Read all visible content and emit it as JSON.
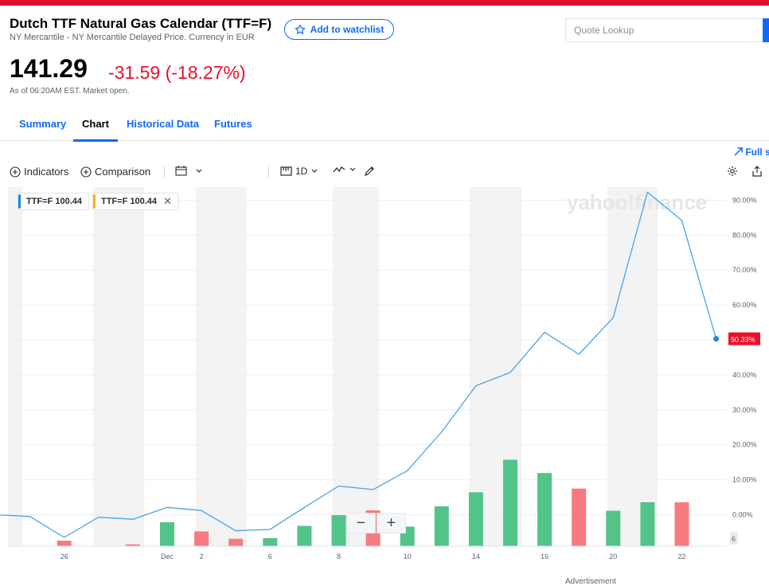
{
  "colors": {
    "accent": "#0f69ff",
    "negative": "#eb0f29",
    "topbar": "#e0102f",
    "up_bar": "#52c48a",
    "down_bar": "#f87a7e",
    "line": "#4aa3e8"
  },
  "quote": {
    "title": "Dutch TTF Natural Gas Calendar (TTF=F)",
    "subtitle": "NY Mercantile - NY Mercantile Delayed Price. Currency in EUR",
    "watchlist_label": "Add to watchlist",
    "price": "141.29",
    "change": "-31.59 (-18.27%)",
    "as_of": "As of 06:20AM EST. Market open."
  },
  "search": {
    "placeholder": "Quote Lookup"
  },
  "tabs": [
    {
      "label": "Summary",
      "active": false
    },
    {
      "label": "Chart",
      "active": true
    },
    {
      "label": "Historical Data",
      "active": false
    },
    {
      "label": "Futures",
      "active": false
    }
  ],
  "fullscreen_label": "Full s",
  "toolbar": {
    "indicators_label": "Indicators",
    "comparison_label": "Comparison",
    "range_label": "1D"
  },
  "legend_chips": [
    {
      "text": "TTF=F  100.44",
      "color": "#1e88e5"
    },
    {
      "text": "TTF=F  100.44",
      "color": "#f5b700"
    }
  ],
  "watermark": "yahoo!finance",
  "advertisement": "Advertisement",
  "chart_data": {
    "type": "line",
    "ylim": [
      -9,
      95
    ],
    "y_ticks": [
      "90.00%",
      "80.00%",
      "70.00%",
      "60.00%",
      "50.00%",
      "40.00%",
      "30.00%",
      "20.00%",
      "10.00%",
      "0.00%"
    ],
    "y_tick_values": [
      90,
      80,
      70,
      60,
      50,
      40,
      30,
      20,
      10,
      0
    ],
    "x_ticks": [
      "26",
      "Dec",
      "2",
      "6",
      "8",
      "10",
      "14",
      "16",
      "20",
      "22"
    ],
    "x_tick_index": [
      2,
      5,
      6,
      8,
      10,
      12,
      14,
      16,
      18,
      20
    ],
    "last_value_label": "50.33%",
    "volume_axis_label": "6",
    "series": [
      {
        "x": [
          "23",
          "24",
          "26",
          "29",
          "30",
          "Dec 1",
          "2",
          "3",
          "6",
          "7",
          "8",
          "9",
          "10",
          "13",
          "14",
          "15",
          "16",
          "17",
          "20",
          "21",
          "22",
          "23"
        ],
        "values": [
          0,
          -0.5,
          -6.5,
          -0.7,
          -1.3,
          2.1,
          1.2,
          -4.6,
          -4.2,
          2.1,
          8.2,
          7.2,
          12.6,
          23.7,
          36.9,
          40.7,
          52.2,
          45.9,
          56.4,
          92.3,
          84.2,
          50.33
        ]
      }
    ],
    "volume": [
      {
        "index": 2,
        "value": 1.5,
        "dir": "down"
      },
      {
        "index": 4,
        "value": 0.5,
        "dir": "down"
      },
      {
        "index": 5,
        "value": 6.5,
        "dir": "up"
      },
      {
        "index": 6,
        "value": 4,
        "dir": "down"
      },
      {
        "index": 7,
        "value": 2,
        "dir": "down"
      },
      {
        "index": 8,
        "value": 2.2,
        "dir": "up"
      },
      {
        "index": 9,
        "value": 5.5,
        "dir": "up"
      },
      {
        "index": 10,
        "value": 8.4,
        "dir": "up"
      },
      {
        "index": 11,
        "value": 9.7,
        "dir": "down"
      },
      {
        "index": 12,
        "value": 5.3,
        "dir": "up"
      },
      {
        "index": 13,
        "value": 10.8,
        "dir": "up"
      },
      {
        "index": 14,
        "value": 14.6,
        "dir": "up"
      },
      {
        "index": 15,
        "value": 23.4,
        "dir": "up"
      },
      {
        "index": 16,
        "value": 19.8,
        "dir": "up"
      },
      {
        "index": 17,
        "value": 15.6,
        "dir": "down"
      },
      {
        "index": 18,
        "value": 9.6,
        "dir": "up"
      },
      {
        "index": 19,
        "value": 11.9,
        "dir": "up"
      },
      {
        "index": 20,
        "value": 11.9,
        "dir": "down"
      }
    ],
    "volume_max": 25
  }
}
